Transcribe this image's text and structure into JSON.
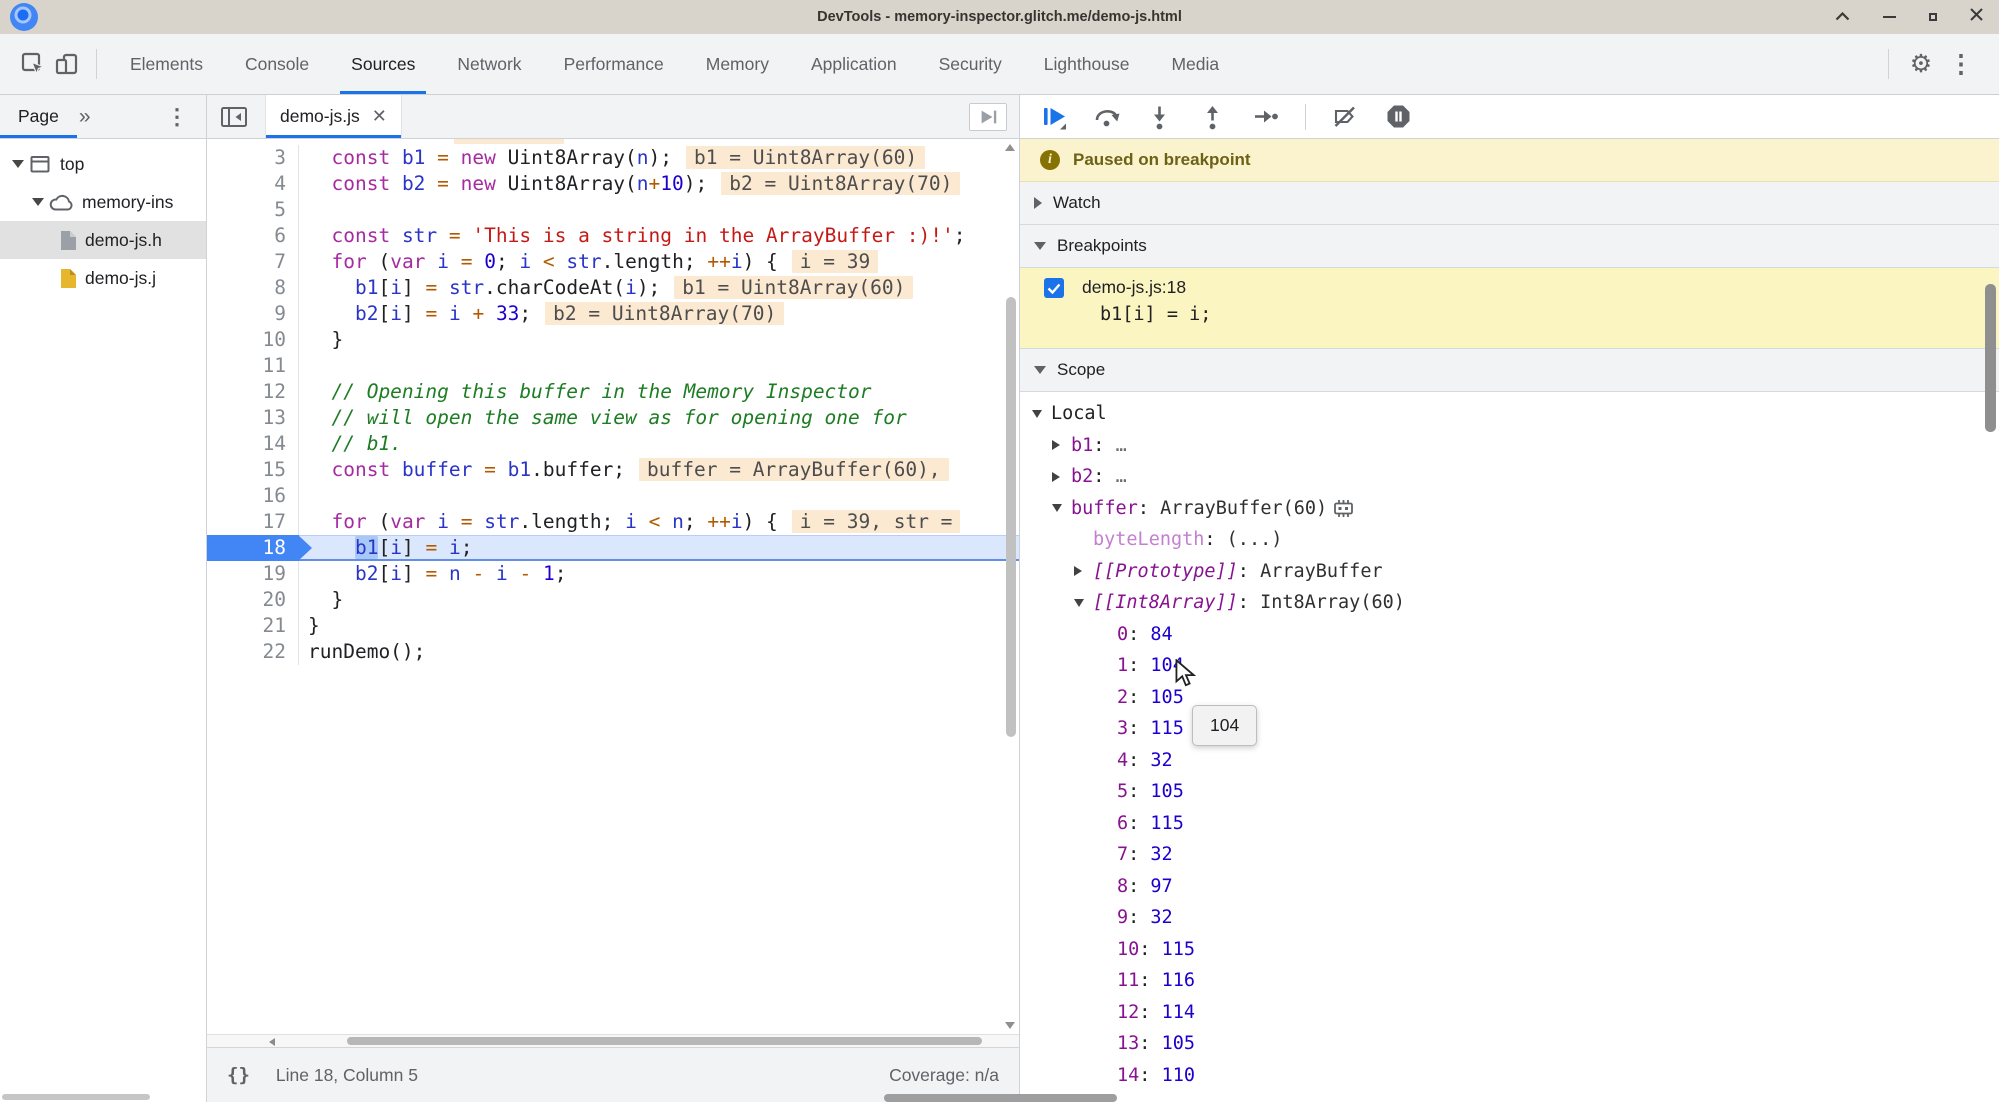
{
  "window": {
    "title": "DevTools - memory-inspector.glitch.me/demo-js.html",
    "controls": [
      "keep-above",
      "minimize",
      "restore",
      "close"
    ]
  },
  "toolbar": {
    "tabs": [
      {
        "label": "Elements",
        "active": false
      },
      {
        "label": "Console",
        "active": false
      },
      {
        "label": "Sources",
        "active": true
      },
      {
        "label": "Network",
        "active": false
      },
      {
        "label": "Performance",
        "active": false
      },
      {
        "label": "Memory",
        "active": false
      },
      {
        "label": "Application",
        "active": false
      },
      {
        "label": "Security",
        "active": false
      },
      {
        "label": "Lighthouse",
        "active": false
      },
      {
        "label": "Media",
        "active": false
      }
    ],
    "right_icons": [
      "settings-gear",
      "kebab-menu"
    ]
  },
  "navigator": {
    "tab_label": "Page",
    "tree": [
      {
        "label": "top",
        "icon": "frame",
        "depth": 0,
        "expanded": true,
        "selected": false
      },
      {
        "label": "memory-ins",
        "icon": "cloud",
        "depth": 1,
        "expanded": true,
        "selected": false
      },
      {
        "label": "demo-js.h",
        "icon": "file-gray",
        "depth": 2,
        "expanded": false,
        "selected": true
      },
      {
        "label": "demo-js.j",
        "icon": "file-yellow",
        "depth": 2,
        "expanded": false,
        "selected": false
      }
    ]
  },
  "editor": {
    "tab_label": "demo-js.js",
    "status": {
      "left": "Line 18, Column 5",
      "right": "Coverage: n/a"
    },
    "lines": [
      {
        "n": 3,
        "tokens": [
          [
            "pl",
            "  "
          ],
          [
            "kw",
            "const"
          ],
          [
            "pl",
            " "
          ],
          [
            "var",
            "b1"
          ],
          [
            "pl",
            " "
          ],
          [
            "op",
            "="
          ],
          [
            "pl",
            " "
          ],
          [
            "kw",
            "new"
          ],
          [
            "pl",
            " Uint8Array("
          ],
          [
            "var",
            "n"
          ],
          [
            "pl",
            ");"
          ]
        ],
        "eval": "b1 = Uint8Array(60)",
        "current": false
      },
      {
        "n": 4,
        "tokens": [
          [
            "pl",
            "  "
          ],
          [
            "kw",
            "const"
          ],
          [
            "pl",
            " "
          ],
          [
            "var",
            "b2"
          ],
          [
            "pl",
            " "
          ],
          [
            "op",
            "="
          ],
          [
            "pl",
            " "
          ],
          [
            "kw",
            "new"
          ],
          [
            "pl",
            " Uint8Array("
          ],
          [
            "var",
            "n"
          ],
          [
            "op",
            "+"
          ],
          [
            "num",
            "10"
          ],
          [
            "pl",
            ");"
          ]
        ],
        "eval": "b2 = Uint8Array(70)",
        "current": false
      },
      {
        "n": 5,
        "tokens": [],
        "eval": null,
        "current": false
      },
      {
        "n": 6,
        "tokens": [
          [
            "pl",
            "  "
          ],
          [
            "kw",
            "const"
          ],
          [
            "pl",
            " "
          ],
          [
            "var",
            "str"
          ],
          [
            "pl",
            " "
          ],
          [
            "op",
            "="
          ],
          [
            "pl",
            " "
          ],
          [
            "str",
            "'This is a string in the ArrayBuffer :)!'"
          ],
          [
            "pl",
            ";"
          ]
        ],
        "eval": null,
        "current": false
      },
      {
        "n": 7,
        "tokens": [
          [
            "pl",
            "  "
          ],
          [
            "kw",
            "for"
          ],
          [
            "pl",
            " ("
          ],
          [
            "kw",
            "var"
          ],
          [
            "pl",
            " "
          ],
          [
            "var",
            "i"
          ],
          [
            "pl",
            " "
          ],
          [
            "op",
            "="
          ],
          [
            "pl",
            " "
          ],
          [
            "num",
            "0"
          ],
          [
            "pl",
            "; "
          ],
          [
            "var",
            "i"
          ],
          [
            "pl",
            " "
          ],
          [
            "op",
            "<"
          ],
          [
            "pl",
            " "
          ],
          [
            "var",
            "str"
          ],
          [
            "pl",
            ".length; "
          ],
          [
            "op",
            "++"
          ],
          [
            "var",
            "i"
          ],
          [
            "pl",
            ") {"
          ]
        ],
        "eval": "i = 39",
        "current": false
      },
      {
        "n": 8,
        "tokens": [
          [
            "pl",
            "    "
          ],
          [
            "var",
            "b1"
          ],
          [
            "pl",
            "["
          ],
          [
            "var",
            "i"
          ],
          [
            "pl",
            "] "
          ],
          [
            "op",
            "="
          ],
          [
            "pl",
            " "
          ],
          [
            "var",
            "str"
          ],
          [
            "pl",
            ".charCodeAt("
          ],
          [
            "var",
            "i"
          ],
          [
            "pl",
            ");"
          ]
        ],
        "eval": "b1 = Uint8Array(60)",
        "current": false
      },
      {
        "n": 9,
        "tokens": [
          [
            "pl",
            "    "
          ],
          [
            "var",
            "b2"
          ],
          [
            "pl",
            "["
          ],
          [
            "var",
            "i"
          ],
          [
            "pl",
            "] "
          ],
          [
            "op",
            "="
          ],
          [
            "pl",
            " "
          ],
          [
            "var",
            "i"
          ],
          [
            "pl",
            " "
          ],
          [
            "op",
            "+"
          ],
          [
            "pl",
            " "
          ],
          [
            "num",
            "33"
          ],
          [
            "pl",
            ";"
          ]
        ],
        "eval": "b2 = Uint8Array(70)",
        "current": false
      },
      {
        "n": 10,
        "tokens": [
          [
            "pl",
            "  }"
          ]
        ],
        "eval": null,
        "current": false
      },
      {
        "n": 11,
        "tokens": [],
        "eval": null,
        "current": false
      },
      {
        "n": 12,
        "tokens": [
          [
            "com",
            "  // Opening this buffer in the Memory Inspector"
          ]
        ],
        "eval": null,
        "current": false
      },
      {
        "n": 13,
        "tokens": [
          [
            "com",
            "  // will open the same view as for opening one for"
          ]
        ],
        "eval": null,
        "current": false
      },
      {
        "n": 14,
        "tokens": [
          [
            "com",
            "  // b1."
          ]
        ],
        "eval": null,
        "current": false
      },
      {
        "n": 15,
        "tokens": [
          [
            "pl",
            "  "
          ],
          [
            "kw",
            "const"
          ],
          [
            "pl",
            " "
          ],
          [
            "var",
            "buffer"
          ],
          [
            "pl",
            " "
          ],
          [
            "op",
            "="
          ],
          [
            "pl",
            " "
          ],
          [
            "var",
            "b1"
          ],
          [
            "pl",
            ".buffer;"
          ]
        ],
        "eval": "buffer = ArrayBuffer(60),",
        "current": false
      },
      {
        "n": 16,
        "tokens": [],
        "eval": null,
        "current": false
      },
      {
        "n": 17,
        "tokens": [
          [
            "pl",
            "  "
          ],
          [
            "kw",
            "for"
          ],
          [
            "pl",
            " ("
          ],
          [
            "kw",
            "var"
          ],
          [
            "pl",
            " "
          ],
          [
            "var",
            "i"
          ],
          [
            "pl",
            " "
          ],
          [
            "op",
            "="
          ],
          [
            "pl",
            " "
          ],
          [
            "var",
            "str"
          ],
          [
            "pl",
            ".length; "
          ],
          [
            "var",
            "i"
          ],
          [
            "pl",
            " "
          ],
          [
            "op",
            "<"
          ],
          [
            "pl",
            " "
          ],
          [
            "var",
            "n"
          ],
          [
            "pl",
            "; "
          ],
          [
            "op",
            "++"
          ],
          [
            "var",
            "i"
          ],
          [
            "pl",
            ") {"
          ]
        ],
        "eval": "i = 39, str =",
        "current": false
      },
      {
        "n": 18,
        "tokens": [
          [
            "pl",
            "    "
          ],
          [
            "hl",
            "b1"
          ],
          [
            "pl",
            "["
          ],
          [
            "var",
            "i"
          ],
          [
            "pl",
            "] "
          ],
          [
            "op",
            "="
          ],
          [
            "pl",
            " "
          ],
          [
            "var",
            "i"
          ],
          [
            "pl",
            ";"
          ]
        ],
        "eval": null,
        "current": true
      },
      {
        "n": 19,
        "tokens": [
          [
            "pl",
            "    "
          ],
          [
            "var",
            "b2"
          ],
          [
            "pl",
            "["
          ],
          [
            "var",
            "i"
          ],
          [
            "pl",
            "] "
          ],
          [
            "op",
            "="
          ],
          [
            "pl",
            " "
          ],
          [
            "var",
            "n"
          ],
          [
            "pl",
            " "
          ],
          [
            "op",
            "-"
          ],
          [
            "pl",
            " "
          ],
          [
            "var",
            "i"
          ],
          [
            "pl",
            " "
          ],
          [
            "op",
            "-"
          ],
          [
            "pl",
            " "
          ],
          [
            "num",
            "1"
          ],
          [
            "pl",
            ";"
          ]
        ],
        "eval": null,
        "current": false
      },
      {
        "n": 20,
        "tokens": [
          [
            "pl",
            "  }"
          ]
        ],
        "eval": null,
        "current": false
      },
      {
        "n": 21,
        "tokens": [
          [
            "pl",
            "}"
          ]
        ],
        "eval": null,
        "current": false
      },
      {
        "n": 22,
        "tokens": [
          [
            "pl",
            "runDemo();"
          ]
        ],
        "eval": null,
        "current": false
      }
    ]
  },
  "debugger": {
    "toolbar_icons": [
      "resume",
      "step-over",
      "step-into",
      "step-out",
      "step",
      "divider",
      "deactivate-breakpoints",
      "pause-on-exceptions"
    ],
    "paused_text": "Paused on breakpoint",
    "watch_label": "Watch",
    "breakpoints_label": "Breakpoints",
    "scope_label": "Scope",
    "breakpoint": {
      "location": "demo-js.js:18",
      "code": "b1[i] = i;",
      "checked": true
    },
    "tooltip": "104",
    "scope_rows": [
      {
        "indent": 0,
        "exp": "down",
        "name": "Local",
        "nstyle": "plain",
        "value": null,
        "vstyle": null,
        "icon": null
      },
      {
        "indent": 1,
        "exp": "right",
        "name": "b1",
        "nstyle": "purple",
        "value": "…",
        "vstyle": "muted",
        "icon": null
      },
      {
        "indent": 1,
        "exp": "right",
        "name": "b2",
        "nstyle": "purple",
        "value": "…",
        "vstyle": "muted",
        "icon": null
      },
      {
        "indent": 1,
        "exp": "down",
        "name": "buffer",
        "nstyle": "purple",
        "value": "ArrayBuffer(60)",
        "vstyle": "obj",
        "icon": "memory"
      },
      {
        "indent": 2,
        "exp": "none",
        "name": "byteLength",
        "nstyle": "faded",
        "value": "(...)",
        "vstyle": "obj",
        "icon": null
      },
      {
        "indent": 2,
        "exp": "right",
        "name": "[[Prototype]]",
        "nstyle": "bracket",
        "value": "ArrayBuffer",
        "vstyle": "obj",
        "icon": null
      },
      {
        "indent": 2,
        "exp": "down",
        "name": "[[Int8Array]]",
        "nstyle": "bracket",
        "value": "Int8Array(60)",
        "vstyle": "obj",
        "icon": null
      },
      {
        "indent": 3,
        "exp": "none",
        "name": "0",
        "nstyle": "purple",
        "value": "84",
        "vstyle": "num",
        "icon": null
      },
      {
        "indent": 3,
        "exp": "none",
        "name": "1",
        "nstyle": "purple",
        "value": "104",
        "vstyle": "num",
        "icon": null
      },
      {
        "indent": 3,
        "exp": "none",
        "name": "2",
        "nstyle": "purple",
        "value": "105",
        "vstyle": "num",
        "icon": null
      },
      {
        "indent": 3,
        "exp": "none",
        "name": "3",
        "nstyle": "purple",
        "value": "115",
        "vstyle": "num",
        "icon": null
      },
      {
        "indent": 3,
        "exp": "none",
        "name": "4",
        "nstyle": "purple",
        "value": "32",
        "vstyle": "num",
        "icon": null
      },
      {
        "indent": 3,
        "exp": "none",
        "name": "5",
        "nstyle": "purple",
        "value": "105",
        "vstyle": "num",
        "icon": null
      },
      {
        "indent": 3,
        "exp": "none",
        "name": "6",
        "nstyle": "purple",
        "value": "115",
        "vstyle": "num",
        "icon": null
      },
      {
        "indent": 3,
        "exp": "none",
        "name": "7",
        "nstyle": "purple",
        "value": "32",
        "vstyle": "num",
        "icon": null
      },
      {
        "indent": 3,
        "exp": "none",
        "name": "8",
        "nstyle": "purple",
        "value": "97",
        "vstyle": "num",
        "icon": null
      },
      {
        "indent": 3,
        "exp": "none",
        "name": "9",
        "nstyle": "purple",
        "value": "32",
        "vstyle": "num",
        "icon": null
      },
      {
        "indent": 3,
        "exp": "none",
        "name": "10",
        "nstyle": "purple",
        "value": "115",
        "vstyle": "num",
        "icon": null
      },
      {
        "indent": 3,
        "exp": "none",
        "name": "11",
        "nstyle": "purple",
        "value": "116",
        "vstyle": "num",
        "icon": null
      },
      {
        "indent": 3,
        "exp": "none",
        "name": "12",
        "nstyle": "purple",
        "value": "114",
        "vstyle": "num",
        "icon": null
      },
      {
        "indent": 3,
        "exp": "none",
        "name": "13",
        "nstyle": "purple",
        "value": "105",
        "vstyle": "num",
        "icon": null
      },
      {
        "indent": 3,
        "exp": "none",
        "name": "14",
        "nstyle": "purple",
        "value": "110",
        "vstyle": "num",
        "icon": null
      }
    ]
  },
  "colors": {
    "accent": "#1a73e8",
    "paused_bg": "#fbf3cd",
    "breakpoint_bg": "#fbf5c2",
    "inline_eval_bg": "#fbe9d2",
    "current_line_bg": "#dbe7fc",
    "scope_name_purple": "#881391",
    "value_blue": "#1c00cf"
  }
}
